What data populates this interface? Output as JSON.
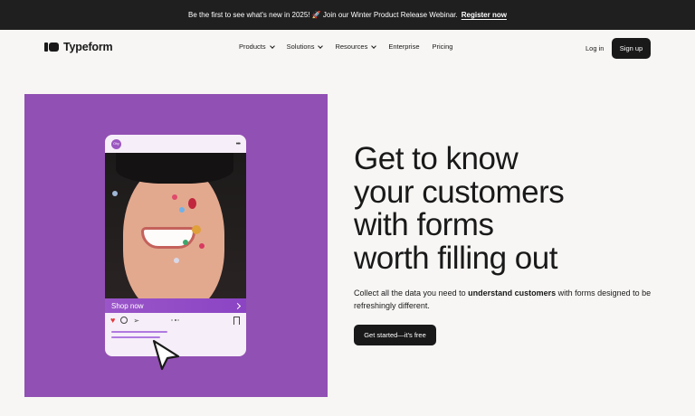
{
  "banner": {
    "text": "Be the first to see what's new in 2025! 🚀 Join our Winter Product Release Webinar.",
    "link": "Register now"
  },
  "nav": {
    "brand": "Typeform",
    "items": [
      {
        "label": "Products",
        "has_dropdown": true
      },
      {
        "label": "Solutions",
        "has_dropdown": true
      },
      {
        "label": "Resources",
        "has_dropdown": true
      },
      {
        "label": "Enterprise",
        "has_dropdown": false
      },
      {
        "label": "Pricing",
        "has_dropdown": false
      }
    ],
    "login": "Log in",
    "signup": "Sign up"
  },
  "hero": {
    "headline": [
      "Get to know",
      "your customers",
      "with forms",
      "worth filling out"
    ],
    "sub_before": "Collect all the data you need to ",
    "sub_bold": "understand customers",
    "sub_after": " with forms designed to be refreshingly different.",
    "cta": "Get started—it's free"
  },
  "card": {
    "shop_label": "Shop now",
    "avatar_text": "Ohy"
  },
  "colors": {
    "hero_bg": "#9150b3",
    "dark": "#191919",
    "banner_bg": "#1f1f1f",
    "page_bg": "#f7f6f4"
  }
}
